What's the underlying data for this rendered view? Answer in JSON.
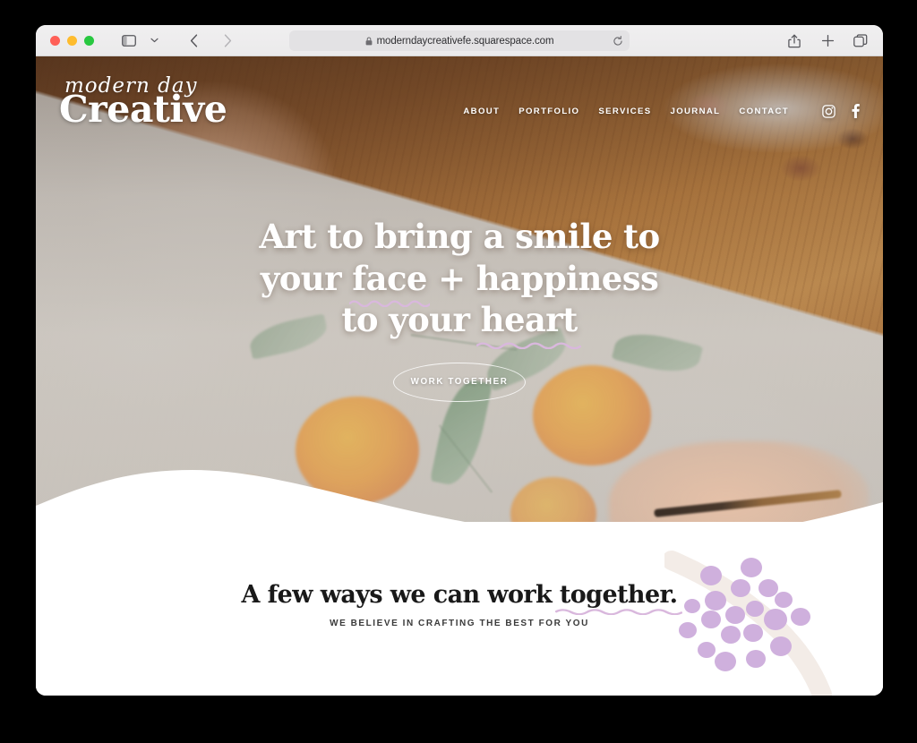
{
  "browser": {
    "traffic_lights": [
      "close",
      "minimize",
      "maximize"
    ],
    "sidebar_toggle_icon": "sidebar-icon",
    "tab_group_chevron_icon": "chevron-down-icon",
    "back_icon": "chevron-left-icon",
    "forward_icon": "chevron-right-icon",
    "address": {
      "lock_icon": "lock-icon",
      "url": "moderndaycreativefe.squarespace.com",
      "reload_icon": "reload-icon"
    },
    "right_actions": [
      {
        "name": "share-icon",
        "label": "Share"
      },
      {
        "name": "plus-icon",
        "label": "New Tab"
      },
      {
        "name": "tabs-icon",
        "label": "Show Tab Overview"
      }
    ]
  },
  "site": {
    "logo": {
      "script_line": "modern day",
      "main_line": "Creative"
    },
    "nav": {
      "links": [
        {
          "label": "ABOUT"
        },
        {
          "label": "PORTFOLIO"
        },
        {
          "label": "SERVICES"
        },
        {
          "label": "JOURNAL"
        },
        {
          "label": "CONTACT"
        }
      ],
      "social": [
        {
          "name": "instagram-icon",
          "label": "Instagram"
        },
        {
          "name": "facebook-icon",
          "label": "Facebook"
        }
      ]
    },
    "hero": {
      "headline_line1_a": "Art to bring a smile to",
      "headline_line2_a": "your ",
      "headline_line2_squiggle": "face",
      "headline_line2_b": " + happiness",
      "headline_line3_a": "to your ",
      "headline_line3_squiggle": "heart",
      "cta_label": "WORK TOGETHER",
      "image_alt": "Hands painting watercolor oranges on paper at a wooden table with a paint palette"
    },
    "work_section": {
      "heading_a": "A few ways we can work ",
      "heading_squiggle": "together.",
      "subheading": "WE BELIEVE IN CRAFTING THE BEST FOR YOU"
    }
  },
  "colors": {
    "squiggle": "#d9b8dd",
    "dots": "#cfb0dd",
    "brushstroke": "#f2ebe6",
    "heading_dark": "#191919",
    "hero_text": "#ffffff",
    "toolbar_bg": "#ebeaeb",
    "address_bg": "#e3e2e4",
    "page_bg": "#ffffff",
    "desktop_bg": "#000000"
  }
}
